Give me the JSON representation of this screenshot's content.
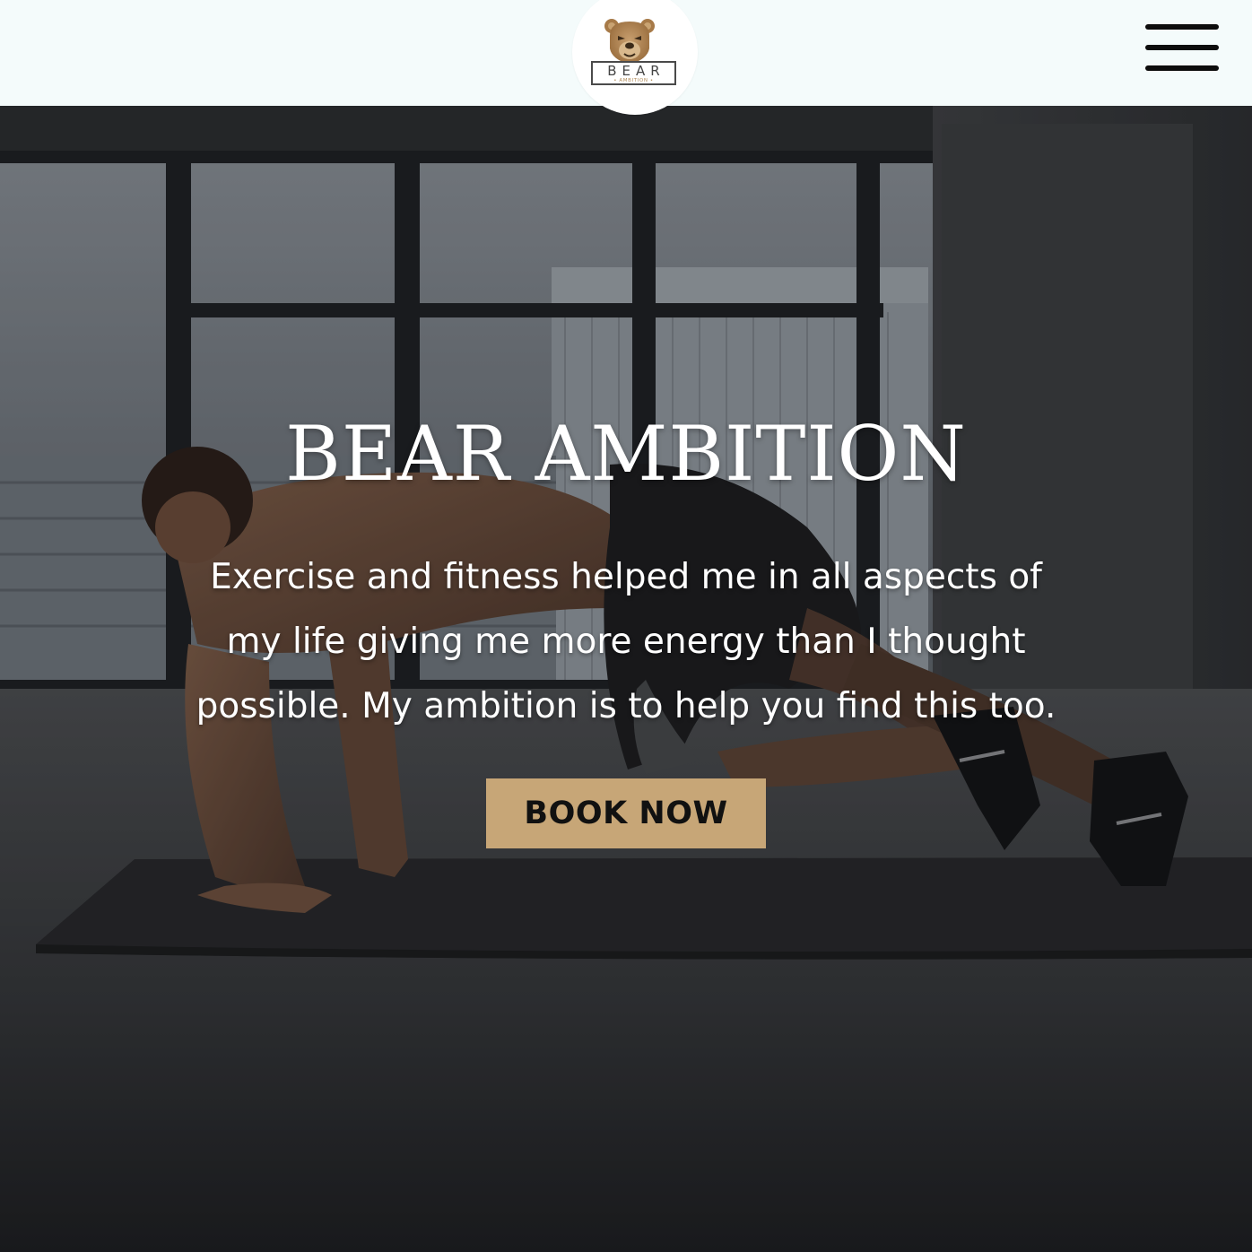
{
  "header": {
    "logo": {
      "wordmark": "BEAR",
      "tagline": "• AMBITION •",
      "icon": "bear-head-icon"
    },
    "menu_icon": "hamburger-menu-icon"
  },
  "hero": {
    "title": "BEAR AMBITION",
    "text": "Exercise and fitness helped me in all aspects of my life giving me more energy than I thought possible. My ambition is to help you find this too.",
    "button_label": "BOOK NOW",
    "background_image": "man-exercising-on-mat-photo"
  },
  "colors": {
    "header_bg": "#f4fbfb",
    "accent_gold": "#c7a677",
    "logo_brown": "#b18a57",
    "hero_text": "#ffffff"
  }
}
